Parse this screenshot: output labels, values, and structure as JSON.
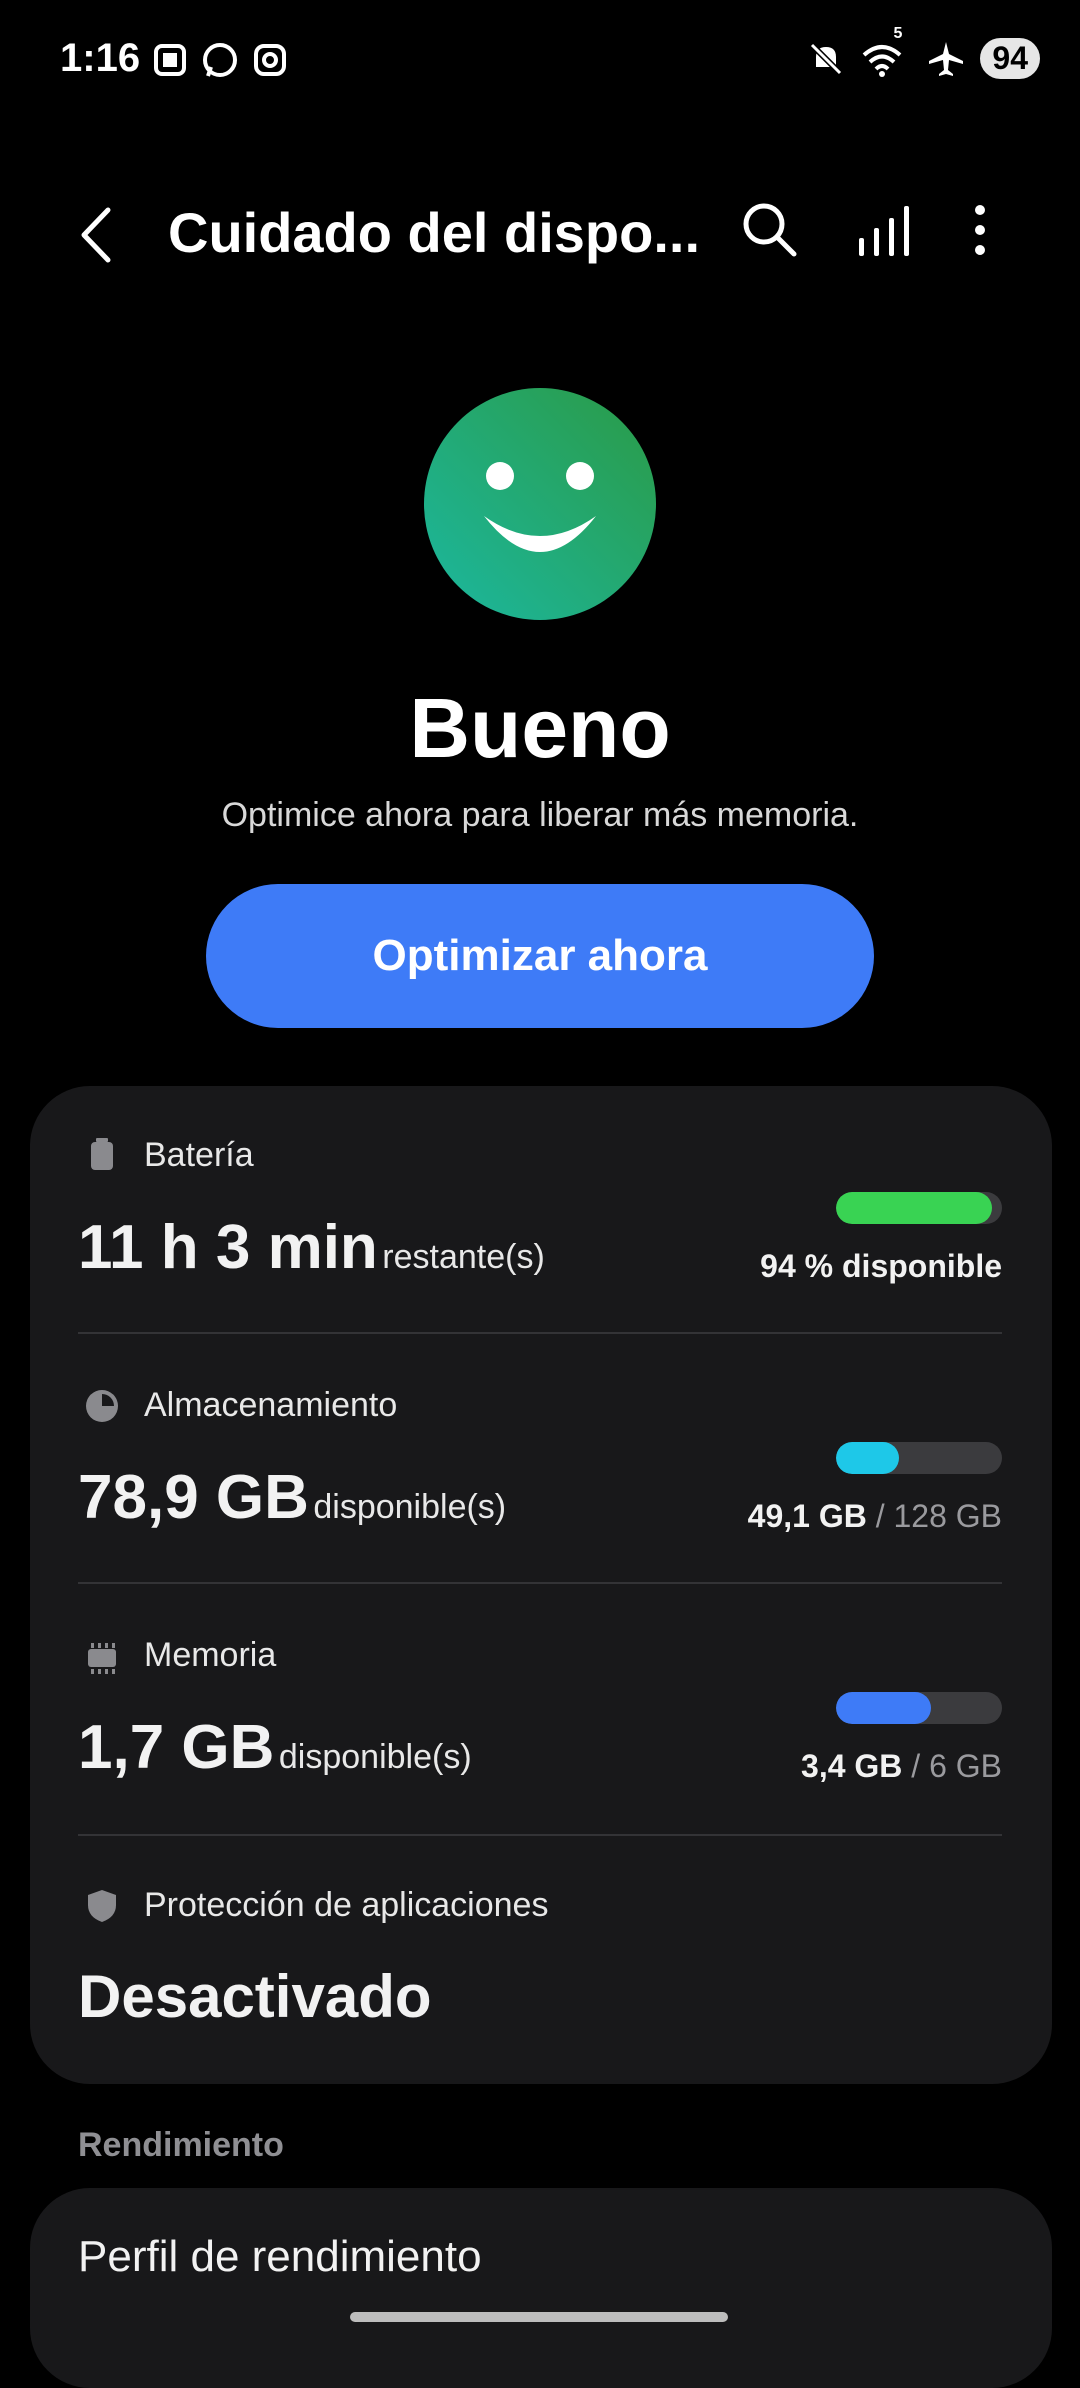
{
  "status_bar": {
    "time": "1:16",
    "left_icons": [
      "screenshot-icon",
      "whatsapp-icon",
      "instagram-icon"
    ],
    "right_icons": [
      "mute-icon",
      "wifi-icon",
      "airplane-icon"
    ],
    "wifi_label": "5",
    "battery": "94"
  },
  "header": {
    "title": "Cuidado del dispo...",
    "icons": [
      "back-icon",
      "search-icon",
      "chart-icon",
      "more-icon"
    ]
  },
  "hero": {
    "status": "Bueno",
    "description": "Optimice ahora para liberar más memoria.",
    "button_label": "Optimizar ahora"
  },
  "items": {
    "battery": {
      "label": "Batería",
      "value": "11 h 3 min",
      "unit": "restante(s)",
      "bar_fraction": 0.94,
      "bar_color": "#39d353",
      "right": "94 % disponible"
    },
    "storage": {
      "label": "Almacenamiento",
      "value": "78,9 GB",
      "unit": "disponible(s)",
      "bar_fraction": 0.38,
      "bar_color": "#1ec8e8",
      "used": "49,1 GB",
      "total": "/ 128 GB"
    },
    "memory": {
      "label": "Memoria",
      "value": "1,7 GB",
      "unit": "disponible(s)",
      "bar_fraction": 0.57,
      "bar_color": "#3e7bf7",
      "used": "3,4 GB",
      "total": "/ 6 GB"
    },
    "protection": {
      "label": "Protección de aplicaciones",
      "value": "Desactivado"
    }
  },
  "performance": {
    "section_label": "Rendimiento",
    "profile_label": "Perfil de rendimiento"
  },
  "colors": {
    "accent": "#3e7bf7",
    "card_bg": "#18181a",
    "smiley_gradient": [
      "#1bb8a0",
      "#2b9a45"
    ]
  }
}
